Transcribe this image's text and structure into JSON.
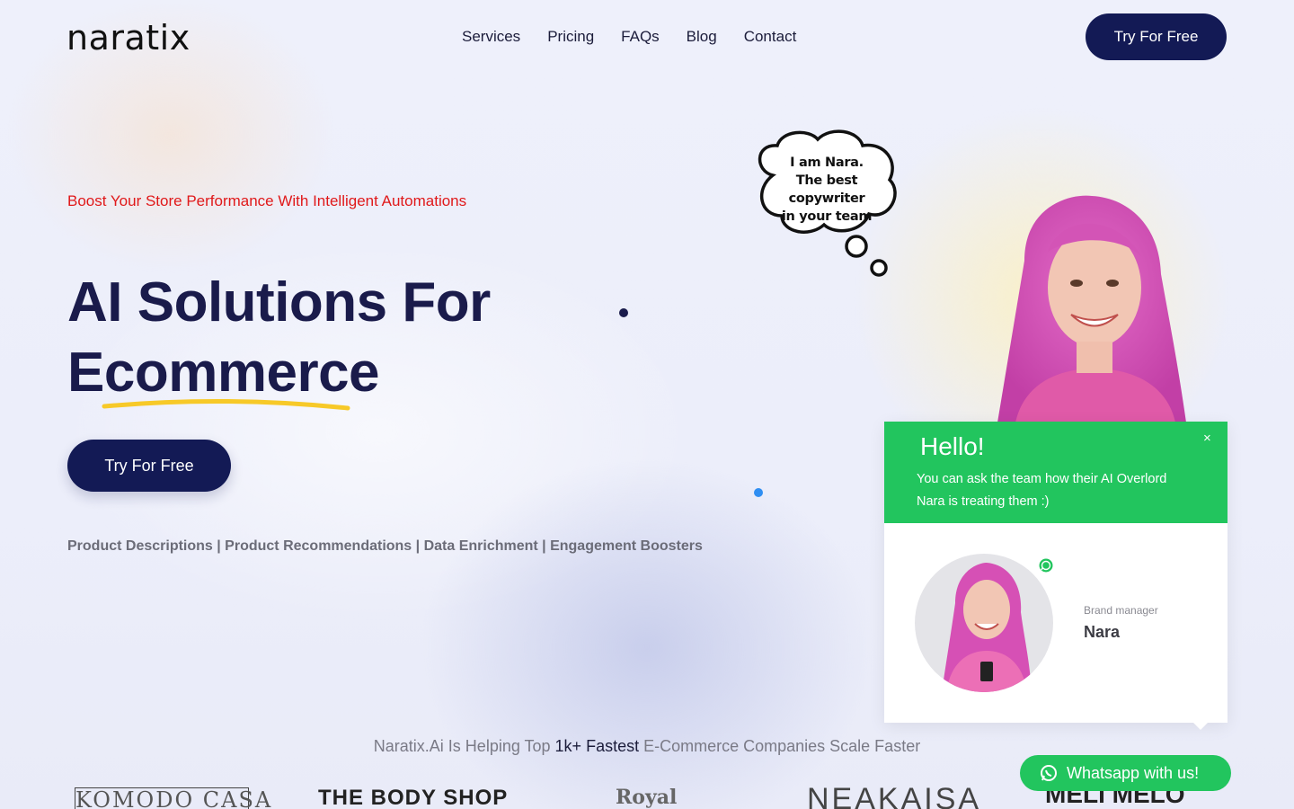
{
  "header": {
    "logo": "naratix",
    "nav": [
      "Services",
      "Pricing",
      "FAQs",
      "Blog",
      "Contact"
    ],
    "cta_label": "Try For Free"
  },
  "hero": {
    "tagline": "Boost Your Store Performance With Intelligent Automations",
    "title_line1": "AI Solutions For",
    "title_line2": "Ecommerce",
    "cta_label": "Try For Free",
    "features": "Product Descriptions | Product Recommendations | Data Enrichment | Engagement Boosters",
    "thought_bubble": [
      "I am Nara.",
      "The best copywriter",
      "in your team"
    ]
  },
  "chat": {
    "greeting": "Hello!",
    "subtitle": "You can ask the team how their AI Overlord Nara is treating them :)",
    "close": "×",
    "agent_role": "Brand manager",
    "agent_name": "Nara"
  },
  "proof": {
    "prefix": "Naratix.Ai Is Helping Top ",
    "highlight": "1k+ Fastest",
    "suffix": " E-Commerce Companies Scale Faster"
  },
  "brands": [
    "KOMODO CASA",
    "THE BODY SHOP",
    "Royal",
    "NEAKAISA",
    "MELI MELO"
  ],
  "whatsapp_button": "Whatsapp with us!",
  "colors": {
    "navy": "#131a55",
    "accent_red": "#e0191a",
    "green": "#22c55e",
    "underline_yellow": "#f7c928"
  }
}
